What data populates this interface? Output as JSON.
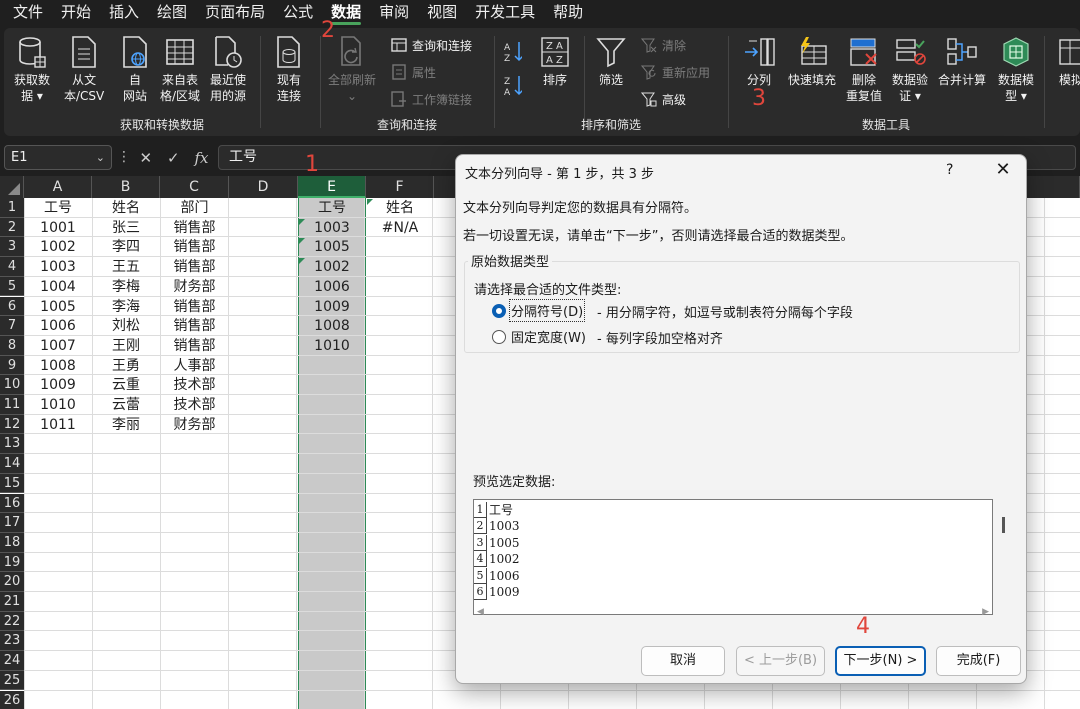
{
  "menu": [
    "文件",
    "开始",
    "插入",
    "绘图",
    "页面布局",
    "公式",
    "数据",
    "审阅",
    "视图",
    "开发工具",
    "帮助"
  ],
  "ribbon": {
    "groups": {
      "get_transform": "获取和转换数据",
      "queries": "查询和连接",
      "sort_filter": "排序和筛选",
      "data_tools": "数据工具"
    },
    "get_data": [
      "获取数",
      "据 ▾"
    ],
    "from_text": [
      "从文",
      "本/CSV"
    ],
    "from_web": [
      "自",
      "网站"
    ],
    "from_table": [
      "来自表",
      "格/区域"
    ],
    "recent_sources": [
      "最近使",
      "用的源"
    ],
    "existing_conn": [
      "现有",
      "连接"
    ],
    "refresh_all": [
      "全部刷新",
      "⌄"
    ],
    "queries_conn": "查询和连接",
    "properties": "属性",
    "edit_links": "工作簿链接",
    "sort_az": "A↓Z",
    "sort_za": "Z↓A",
    "sort": "排序",
    "filter": "筛选",
    "clear": "清除",
    "reapply": "重新应用",
    "advanced": "高级",
    "text_to_cols": "分列",
    "flash_fill": "快速填充",
    "remove_dup": [
      "删除",
      "重复值"
    ],
    "data_validation": [
      "数据验",
      "证 ▾"
    ],
    "consolidate": "合并计算",
    "data_model": [
      "数据模",
      "型 ▾"
    ],
    "whatif": "模拟"
  },
  "annotations": [
    "1",
    "2",
    "3",
    "4"
  ],
  "namebox": "E1",
  "formula_sep": "⋮",
  "formula_icons": [
    "✕",
    "✓",
    "fx"
  ],
  "formula": "工号",
  "columns": [
    "A",
    "B",
    "C",
    "D",
    "E",
    "F"
  ],
  "rows": [
    "1",
    "2",
    "3",
    "4",
    "5",
    "6",
    "7",
    "8",
    "9",
    "10",
    "11",
    "12",
    "13",
    "14",
    "15",
    "16",
    "17",
    "18",
    "19",
    "20",
    "21",
    "22",
    "23",
    "24",
    "25",
    "26"
  ],
  "sheet": {
    "A": [
      "工号",
      "1001",
      "1002",
      "1003",
      "1004",
      "1005",
      "1006",
      "1007",
      "1008",
      "1009",
      "1010",
      "1011"
    ],
    "B": [
      "姓名",
      "张三",
      "李四",
      "王五",
      "李梅",
      "李海",
      "刘松",
      "王刚",
      "王勇",
      "云重",
      "云蕾",
      "李丽"
    ],
    "C": [
      "部门",
      "销售部",
      "销售部",
      "销售部",
      "财务部",
      "销售部",
      "销售部",
      "销售部",
      "人事部",
      "技术部",
      "技术部",
      "财务部"
    ],
    "E": [
      "工号",
      "1003",
      "1005",
      "1002",
      "1006",
      "1009",
      "1008",
      "1010"
    ],
    "F": [
      "姓名",
      "#N/A"
    ]
  },
  "dialog": {
    "title": "文本分列向导 - 第 1 步，共 3 步",
    "help": "?",
    "close": "✕",
    "line1": "文本分列向导判定您的数据具有分隔符。",
    "line2": "若一切设置无误，请单击“下一步”，否则请选择最合适的数据类型。",
    "group_legend": "原始数据类型",
    "prompt": "请选择最合适的文件类型:",
    "opt_delimited": "分隔符号(D)",
    "opt_delimited_desc": "- 用分隔字符，如逗号或制表符分隔每个字段",
    "opt_fixed": "固定宽度(W)",
    "opt_fixed_desc": "- 每列字段加空格对齐",
    "preview_label": "预览选定数据:",
    "preview_rows": [
      {
        "n": "1",
        "v": "工号"
      },
      {
        "n": "2",
        "v": "1003"
      },
      {
        "n": "3",
        "v": "1005"
      },
      {
        "n": "4",
        "v": "1002"
      },
      {
        "n": "5",
        "v": "1006"
      },
      {
        "n": "6",
        "v": "1009"
      }
    ],
    "scroll_left": "◀",
    "scroll_right": "▶",
    "btn_cancel": "取消",
    "btn_back": "< 上一步(B)",
    "btn_next": "下一步(N) >",
    "btn_finish": "完成(F)"
  },
  "colors": {
    "accent_green": "#2e8b57",
    "red_annotation": "#e0463c",
    "primary_blue": "#0a5fb4"
  }
}
